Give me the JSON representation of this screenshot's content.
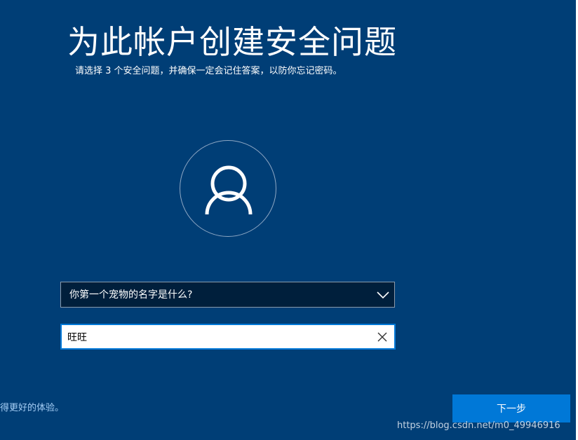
{
  "page": {
    "title": "为此帐户创建安全问题",
    "subtitle": "请选择 3 个安全问题，并确保一定会记住答案，以防你忘记密码。"
  },
  "avatar": {
    "icon": "user-icon"
  },
  "security_question": {
    "selected": "你第一个宠物的名字是什么?",
    "icon": "chevron-down-icon"
  },
  "answer": {
    "value": "旺旺",
    "clear_icon": "close-icon"
  },
  "footer": {
    "link_text": "得更好的体验。",
    "next_label": "下一步"
  },
  "watermark": {
    "text": "https://blog.csdn.net/m0_49946916"
  },
  "colors": {
    "background": "#003e76",
    "accent": "#0078d7",
    "select_background": "#001f3c"
  }
}
